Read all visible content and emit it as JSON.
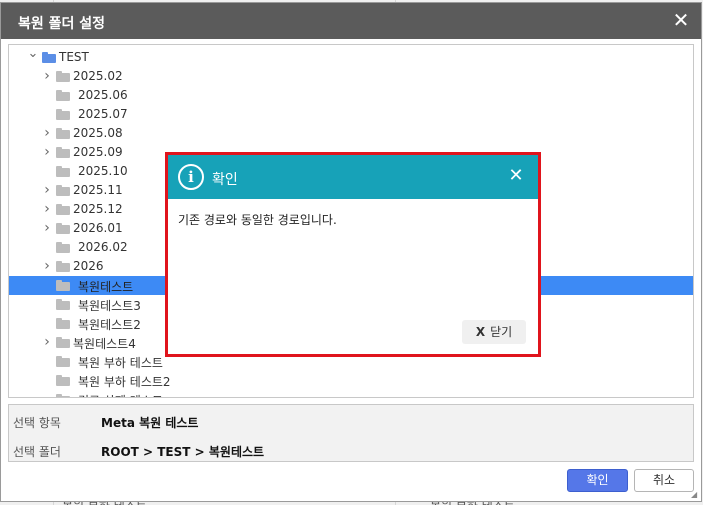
{
  "dialog": {
    "title": "복원 폴더 설정",
    "close_glyph": "✕"
  },
  "tree": {
    "items": [
      {
        "label": "TEST",
        "icon": "folder-blue-icon",
        "arrow": "expanded",
        "depth": 0
      },
      {
        "label": "2025.02",
        "icon": "folder-icon",
        "arrow": "collapsed",
        "depth": 1
      },
      {
        "label": "2025.06",
        "icon": "folder-icon",
        "arrow": "none",
        "depth": 1
      },
      {
        "label": "2025.07",
        "icon": "folder-icon",
        "arrow": "none",
        "depth": 1
      },
      {
        "label": "2025.08",
        "icon": "folder-icon",
        "arrow": "collapsed",
        "depth": 1
      },
      {
        "label": "2025.09",
        "icon": "folder-icon",
        "arrow": "collapsed",
        "depth": 1
      },
      {
        "label": "2025.10",
        "icon": "folder-icon",
        "arrow": "none",
        "depth": 1
      },
      {
        "label": "2025.11",
        "icon": "folder-icon",
        "arrow": "collapsed",
        "depth": 1
      },
      {
        "label": "2025.12",
        "icon": "folder-icon",
        "arrow": "collapsed",
        "depth": 1
      },
      {
        "label": "2026.01",
        "icon": "folder-icon",
        "arrow": "collapsed",
        "depth": 1
      },
      {
        "label": "2026.02",
        "icon": "folder-icon",
        "arrow": "none",
        "depth": 1
      },
      {
        "label": "2026",
        "icon": "folder-icon",
        "arrow": "collapsed",
        "depth": 1
      },
      {
        "label": "복원테스트",
        "icon": "folder-icon",
        "arrow": "none",
        "depth": 1,
        "selected": true
      },
      {
        "label": "복원테스트3",
        "icon": "folder-icon",
        "arrow": "none",
        "depth": 1
      },
      {
        "label": "복원테스트2",
        "icon": "folder-icon",
        "arrow": "none",
        "depth": 1
      },
      {
        "label": "복원테스트4",
        "icon": "folder-icon",
        "arrow": "collapsed",
        "depth": 1
      },
      {
        "label": "복원 부하 테스트",
        "icon": "folder-icon",
        "arrow": "none",
        "depth": 1
      },
      {
        "label": "복원 부하 테스트2",
        "icon": "folder-icon",
        "arrow": "none",
        "depth": 1
      },
      {
        "label": "경로 삭제 테스트",
        "icon": "folder-icon",
        "arrow": "none",
        "depth": 1
      }
    ]
  },
  "info": {
    "selected_item_label": "선택 항목",
    "selected_item_value": "Meta 복원 테스트",
    "selected_folder_label": "선택 폴더",
    "selected_folder_value": "ROOT > TEST > 복원테스트"
  },
  "footer": {
    "confirm_label": "확인",
    "cancel_label": "취소"
  },
  "confirm_modal": {
    "title": "확인",
    "info_glyph": "i",
    "close_glyph": "✕",
    "message": "기존 경로와 동일한 경로입니다.",
    "close_button_x": "X",
    "close_button_label": "닫기"
  },
  "background": {
    "partial_text_left": "복원 부하 테스트",
    "partial_text_right": "복원 부하 테스트"
  },
  "colors": {
    "title_bar": "#5b5b5b",
    "selection": "#3d8af5",
    "primary_button": "#5577e8",
    "modal_header": "#17a2b8",
    "highlight_border": "#e0141c"
  }
}
